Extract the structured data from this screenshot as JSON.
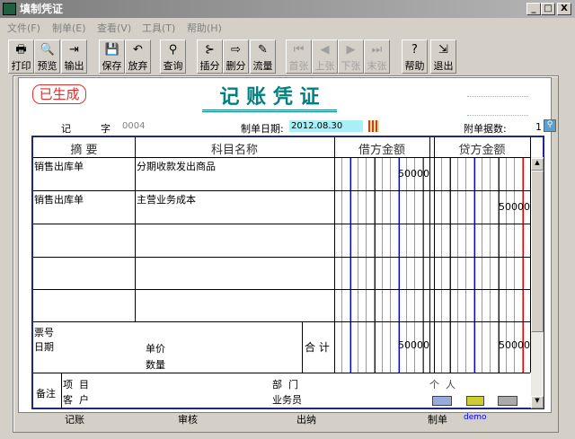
{
  "window": {
    "title": "填制凭证",
    "min": "_",
    "max": "□",
    "close": "X"
  },
  "menu": [
    "文件(F)",
    "制单(E)",
    "查看(V)",
    "工具(T)",
    "帮助(H)"
  ],
  "toolbar": [
    {
      "label": "打印",
      "icon": "printer-icon",
      "glyph": "🖶",
      "enabled": true
    },
    {
      "label": "预览",
      "icon": "preview-icon",
      "glyph": "🔍",
      "enabled": true
    },
    {
      "label": "输出",
      "icon": "export-icon",
      "glyph": "⇥",
      "enabled": true
    },
    {
      "label": "保存",
      "icon": "save-icon",
      "glyph": "💾",
      "enabled": true
    },
    {
      "label": "放弃",
      "icon": "undo-icon",
      "glyph": "↶",
      "enabled": true
    },
    {
      "label": "查询",
      "icon": "binoculars-icon",
      "glyph": "⚲",
      "enabled": true
    },
    {
      "label": "插分",
      "icon": "insert-row-icon",
      "glyph": "⊱",
      "enabled": true
    },
    {
      "label": "删分",
      "icon": "delete-row-icon",
      "glyph": "⇨",
      "enabled": true
    },
    {
      "label": "流量",
      "icon": "cashflow-icon",
      "glyph": "✎",
      "enabled": true
    },
    {
      "label": "首张",
      "icon": "first-icon",
      "glyph": "⏮",
      "enabled": false
    },
    {
      "label": "上张",
      "icon": "prev-icon",
      "glyph": "◀",
      "enabled": false
    },
    {
      "label": "下张",
      "icon": "next-icon",
      "glyph": "▶",
      "enabled": false
    },
    {
      "label": "末张",
      "icon": "last-icon",
      "glyph": "⏭",
      "enabled": false
    },
    {
      "label": "帮助",
      "icon": "help-icon",
      "glyph": "?",
      "enabled": true
    },
    {
      "label": "退出",
      "icon": "exit-icon",
      "glyph": "⇲",
      "enabled": true
    }
  ],
  "voucher": {
    "stamp": "已生成",
    "title": "记 账 凭 证",
    "type_label": "记",
    "zi_label": "字",
    "number": "0004",
    "date_label": "制单日期:",
    "date": "2012.08.30",
    "attach_label": "附单据数:",
    "attach_count": "1",
    "headers": {
      "summary": "摘 要",
      "account": "科目名称",
      "debit": "借方金额",
      "credit": "贷方金额"
    },
    "rows": [
      {
        "summary": "销售出库单",
        "account": "分期收款发出商品",
        "debit": "50000",
        "credit": ""
      },
      {
        "summary": "销售出库单",
        "account": "主营业务成本",
        "debit": "",
        "credit": "50000"
      },
      {
        "summary": "",
        "account": "",
        "debit": "",
        "credit": ""
      },
      {
        "summary": "",
        "account": "",
        "debit": "",
        "credit": ""
      }
    ],
    "ticket_label": "票号",
    "date_field_label": "日期",
    "price_label": "单价",
    "qty_label": "数量",
    "total_label": "合 计",
    "total_debit": "50000",
    "total_credit": "50000",
    "remark_label": "备注",
    "project_label": "项  目",
    "customer_label": "客  户",
    "dept_label": "部  门",
    "salesman_label": "业务员",
    "person_label": "个  人",
    "bookkeeper_label": "记账",
    "auditor_label": "审核",
    "cashier_label": "出纳",
    "maker_label": "制单",
    "maker": "demo"
  },
  "colors": {
    "title": "#008080",
    "stamp": "#e03030",
    "maker": "#0000ff",
    "date_bg": "#a8f0f8"
  }
}
